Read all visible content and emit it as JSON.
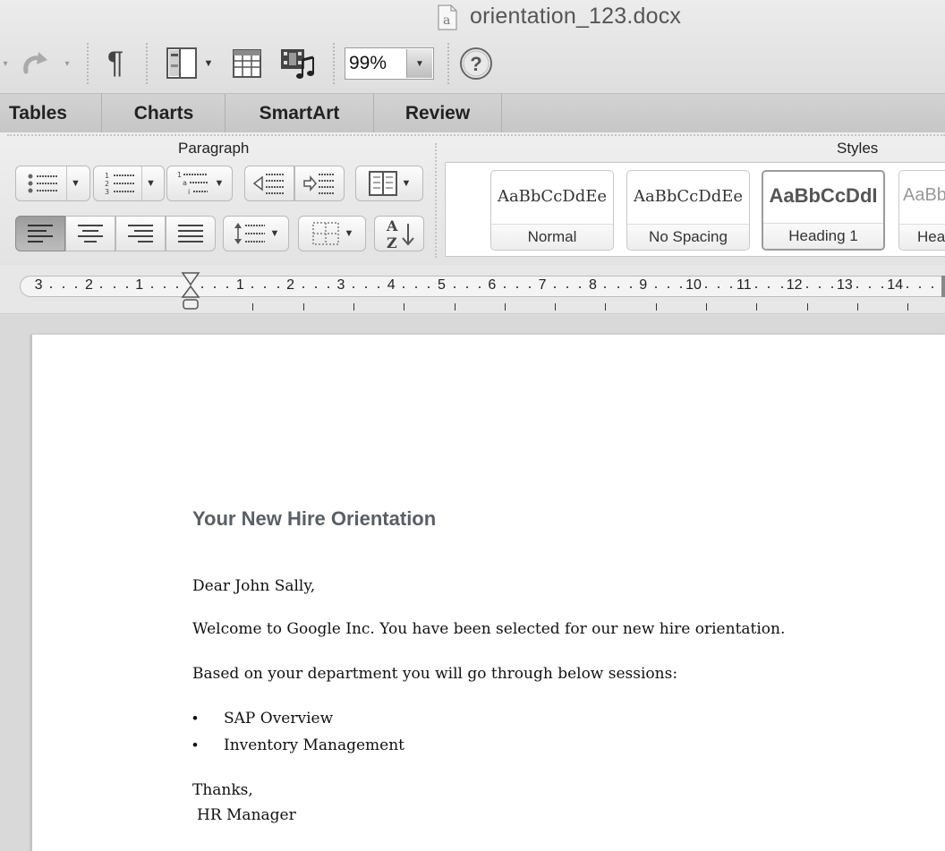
{
  "window": {
    "title": "orientation_123.docx"
  },
  "toolbar": {
    "zoom": "99%",
    "pilcrow": "¶",
    "help": "?"
  },
  "tabs": [
    "Tables",
    "Charts",
    "SmartArt",
    "Review"
  ],
  "ribbon": {
    "paragraph_label": "Paragraph",
    "styles_label": "Styles",
    "styles": [
      {
        "sample": "AaBbCcDdEe",
        "name": "Normal"
      },
      {
        "sample": "AaBbCcDdEe",
        "name": "No Spacing"
      },
      {
        "sample": "AaBbCcDdI",
        "name": "Heading 1"
      },
      {
        "sample": "AaBb",
        "name": "Hea"
      }
    ],
    "sort_label": "AZ"
  },
  "ruler": {
    "labels": [
      "3",
      "2",
      "1",
      "1",
      "2",
      "3",
      "4",
      "5",
      "6",
      "7",
      "8",
      "9",
      "10",
      "11",
      "12",
      "13",
      "14"
    ]
  },
  "document": {
    "heading": "Your New Hire Orientation",
    "salutation": "Dear John Sally,",
    "para1": "Welcome to Google Inc. You have been selected for our new hire orientation.",
    "para2": "Based on your department you will go through below sessions:",
    "bullets": [
      "SAP Overview",
      "Inventory Management"
    ],
    "closing": "Thanks,",
    "signature": "HR Manager"
  }
}
